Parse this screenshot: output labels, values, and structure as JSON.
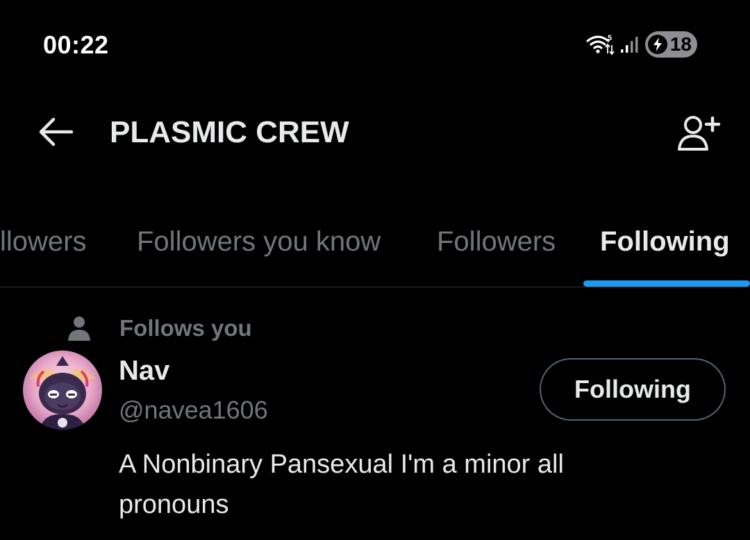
{
  "status_bar": {
    "time": "00:22",
    "wifi_badge": "5",
    "battery_level": "18",
    "icons": [
      "wifi-icon",
      "signal-icon",
      "charging-bolt-icon"
    ]
  },
  "header": {
    "title": "PLASMIC CREW",
    "back_icon": "back-arrow-icon",
    "add_icon": "add-user-icon"
  },
  "tabs": [
    {
      "label": "llowers",
      "active": false
    },
    {
      "label": "Followers you know",
      "active": false
    },
    {
      "label": "Followers",
      "active": false
    },
    {
      "label": "Following",
      "active": true
    }
  ],
  "colors": {
    "background": "#000000",
    "primary_text": "#e7e9ea",
    "secondary_text": "#71767b",
    "accent": "#1d9bf0",
    "border": "#2f3336"
  },
  "user": {
    "follows_you_label": "Follows you",
    "display_name": "Nav",
    "handle": "@navea1606",
    "button_label": "Following",
    "bio": "A Nonbinary Pansexual I'm a minor all pronouns"
  }
}
